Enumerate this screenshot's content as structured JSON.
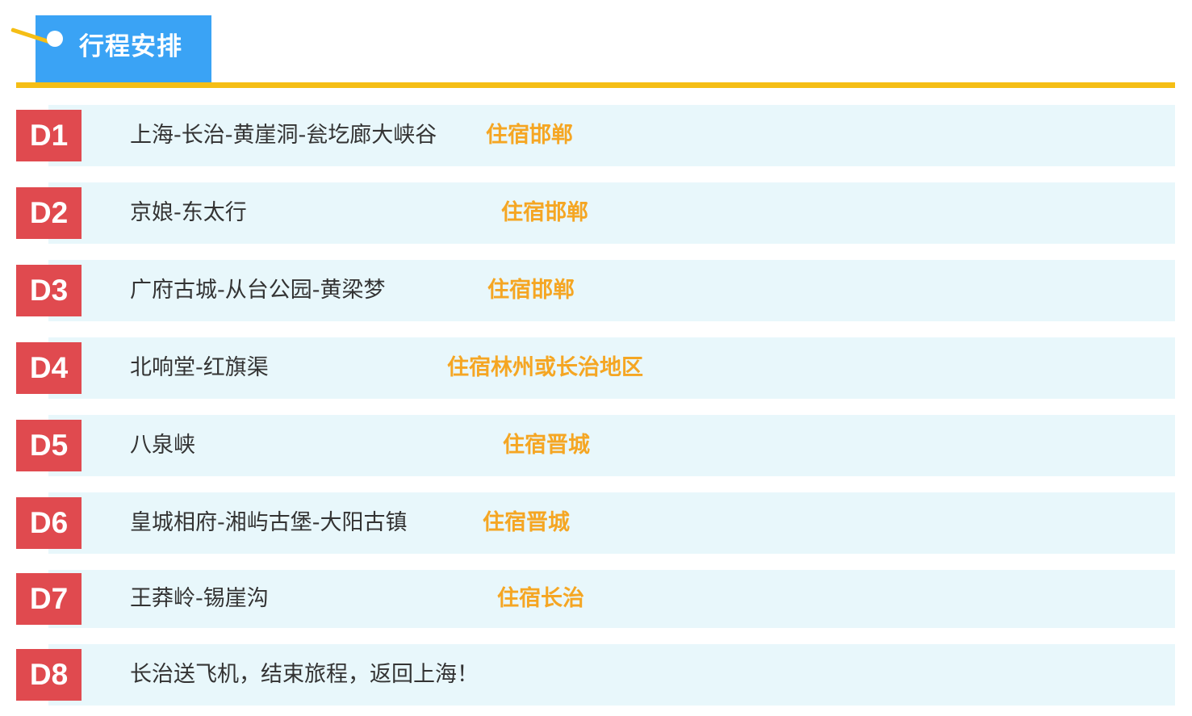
{
  "section_title": "行程安排",
  "colors": {
    "title_tab": "#3aa3f5",
    "accent_rule": "#f5be15",
    "day_badge": "#e04a4f",
    "row_background": "#e8f7fb",
    "route_text": "#333333",
    "stay_text": "#f5a623"
  },
  "itinerary": [
    {
      "day": "D1",
      "route": "上海-长治-黄崖洞-瓮圪廊大峡谷",
      "stay": "住宿邯郸"
    },
    {
      "day": "D2",
      "route": "京娘-东太行",
      "stay": "住宿邯郸"
    },
    {
      "day": "D3",
      "route": "广府古城-从台公园-黄梁梦",
      "stay": "住宿邯郸"
    },
    {
      "day": "D4",
      "route": "北响堂-红旗渠",
      "stay": "住宿林州或长治地区"
    },
    {
      "day": "D5",
      "route": "八泉峡",
      "stay": "住宿晋城"
    },
    {
      "day": "D6",
      "route": "皇城相府-湘屿古堡-大阳古镇",
      "stay": "住宿晋城"
    },
    {
      "day": "D7",
      "route": "王莽岭-锡崖沟",
      "stay": "住宿长治"
    },
    {
      "day": "D8",
      "route": "长治送飞机，结束旅程，返回上海！",
      "stay": ""
    }
  ]
}
